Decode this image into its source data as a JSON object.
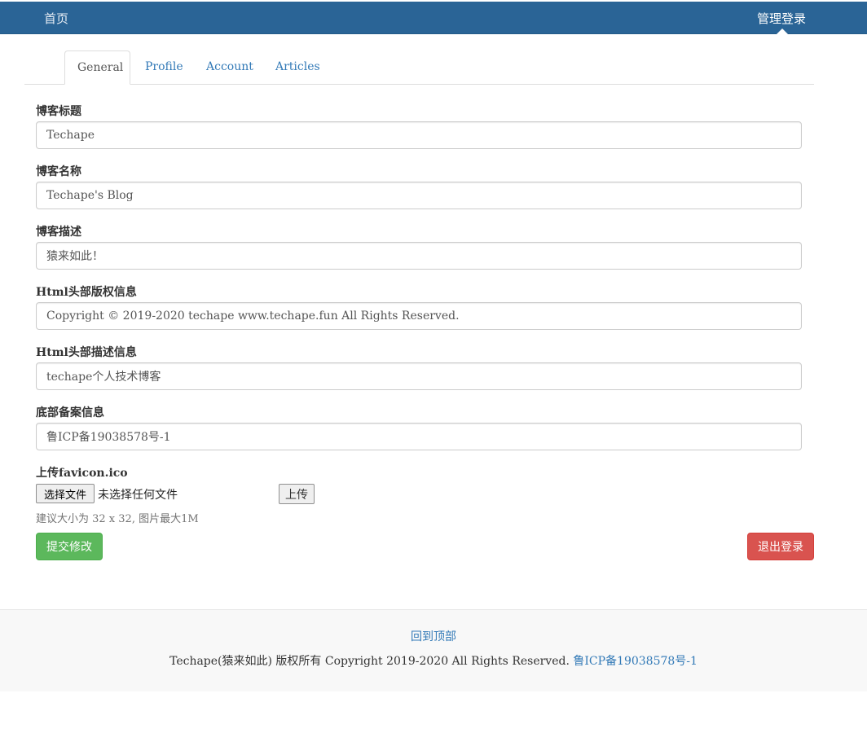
{
  "navbar": {
    "home": "首页",
    "admin_login": "管理登录",
    "bg_color": "#2a6496"
  },
  "tabs": [
    {
      "label": "General",
      "active": true
    },
    {
      "label": "Profile",
      "active": false
    },
    {
      "label": "Account",
      "active": false
    },
    {
      "label": "Articles",
      "active": false
    }
  ],
  "form": {
    "fields": [
      {
        "label": "博客标题",
        "value": "Techape"
      },
      {
        "label": "博客名称",
        "value": "Techape's Blog"
      },
      {
        "label": "博客描述",
        "value": "猿来如此！"
      },
      {
        "label": "Html头部版权信息",
        "value": "Copyright © 2019-2020 techape www.techape.fun All Rights Reserved."
      },
      {
        "label": "Html头部描述信息",
        "value": "techape个人技术博客"
      },
      {
        "label": "底部备案信息",
        "value": "鲁ICP备19038578号-1"
      }
    ],
    "favicon": {
      "label": "上传favicon.ico",
      "choose_button": "选择文件",
      "no_file": "未选择任何文件",
      "upload_button": "上传",
      "hint": "建议大小为 32 x 32, 图片最大1M"
    },
    "submit_button": "提交修改",
    "logout_button": "退出登录"
  },
  "footer": {
    "back_to_top": "回到顶部",
    "copyright": "Techape(猿来如此) 版权所有 Copyright 2019-2020 All Rights Reserved.",
    "icp": "鲁ICP备19038578号-1"
  },
  "colors": {
    "link": "#337ab7",
    "success": "#5cb85c",
    "danger": "#d9534f"
  }
}
